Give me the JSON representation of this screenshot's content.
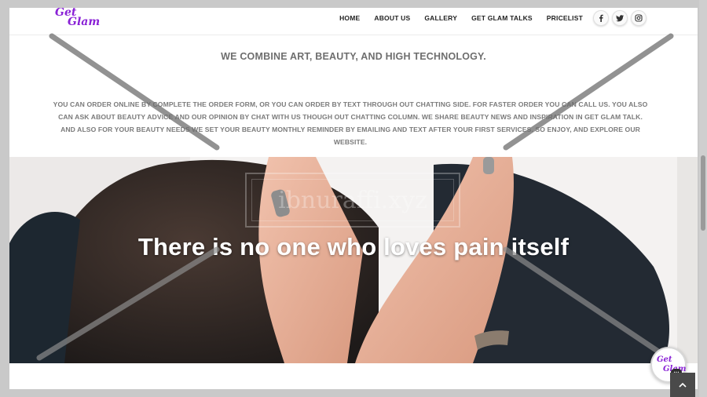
{
  "brand": {
    "logo_line1": "Get",
    "logo_line2": "Glam",
    "color": "#8a22d6"
  },
  "nav": {
    "items": [
      {
        "label": "HOME"
      },
      {
        "label": "ABOUT US"
      },
      {
        "label": "GALLERY"
      },
      {
        "label": "GET GLAM TALKS"
      },
      {
        "label": "PRICELIST"
      }
    ]
  },
  "social": {
    "facebook": "f",
    "twitter": "t",
    "instagram": "ig"
  },
  "content": {
    "tagline": "WE COMBINE ART, BEAUTY, AND HIGH TECHNOLOGY.",
    "paragraph": "YOU CAN ORDER ONLINE BY COMPLETE THE ORDER FORM, OR YOU CAN ORDER BY TEXT THROUGH OUT CHATTING SIDE. FOR FASTER ORDER YOU CAN CALL US. YOU ALSO CAN ASK ABOUT BEAUTY ADVICE AND OUR OPINION BY CHAT WITH US THOUGH OUT CHATTING COLUMN. WE SHARE BEAUTY NEWS AND INSPIRATION IN GET GLAM TALK. AND ALSO FOR YOUR BEAUTY NEEDS WE SET YOUR BEAUTY MONTHLY REMINDER BY EMAILING AND TEXT AFTER YOUR FIRST SERVICES. SO ENJOY, AND EXPLORE OUR WEBSITE."
  },
  "hero": {
    "title": "There is no one who loves pain itself"
  },
  "watermark": {
    "text": "ibnuraffi.xyz"
  },
  "chat": {
    "line1": "Get",
    "line2": "Glam",
    "dots": "..."
  },
  "back_to_top": {
    "icon": "chevron-up-icon"
  }
}
